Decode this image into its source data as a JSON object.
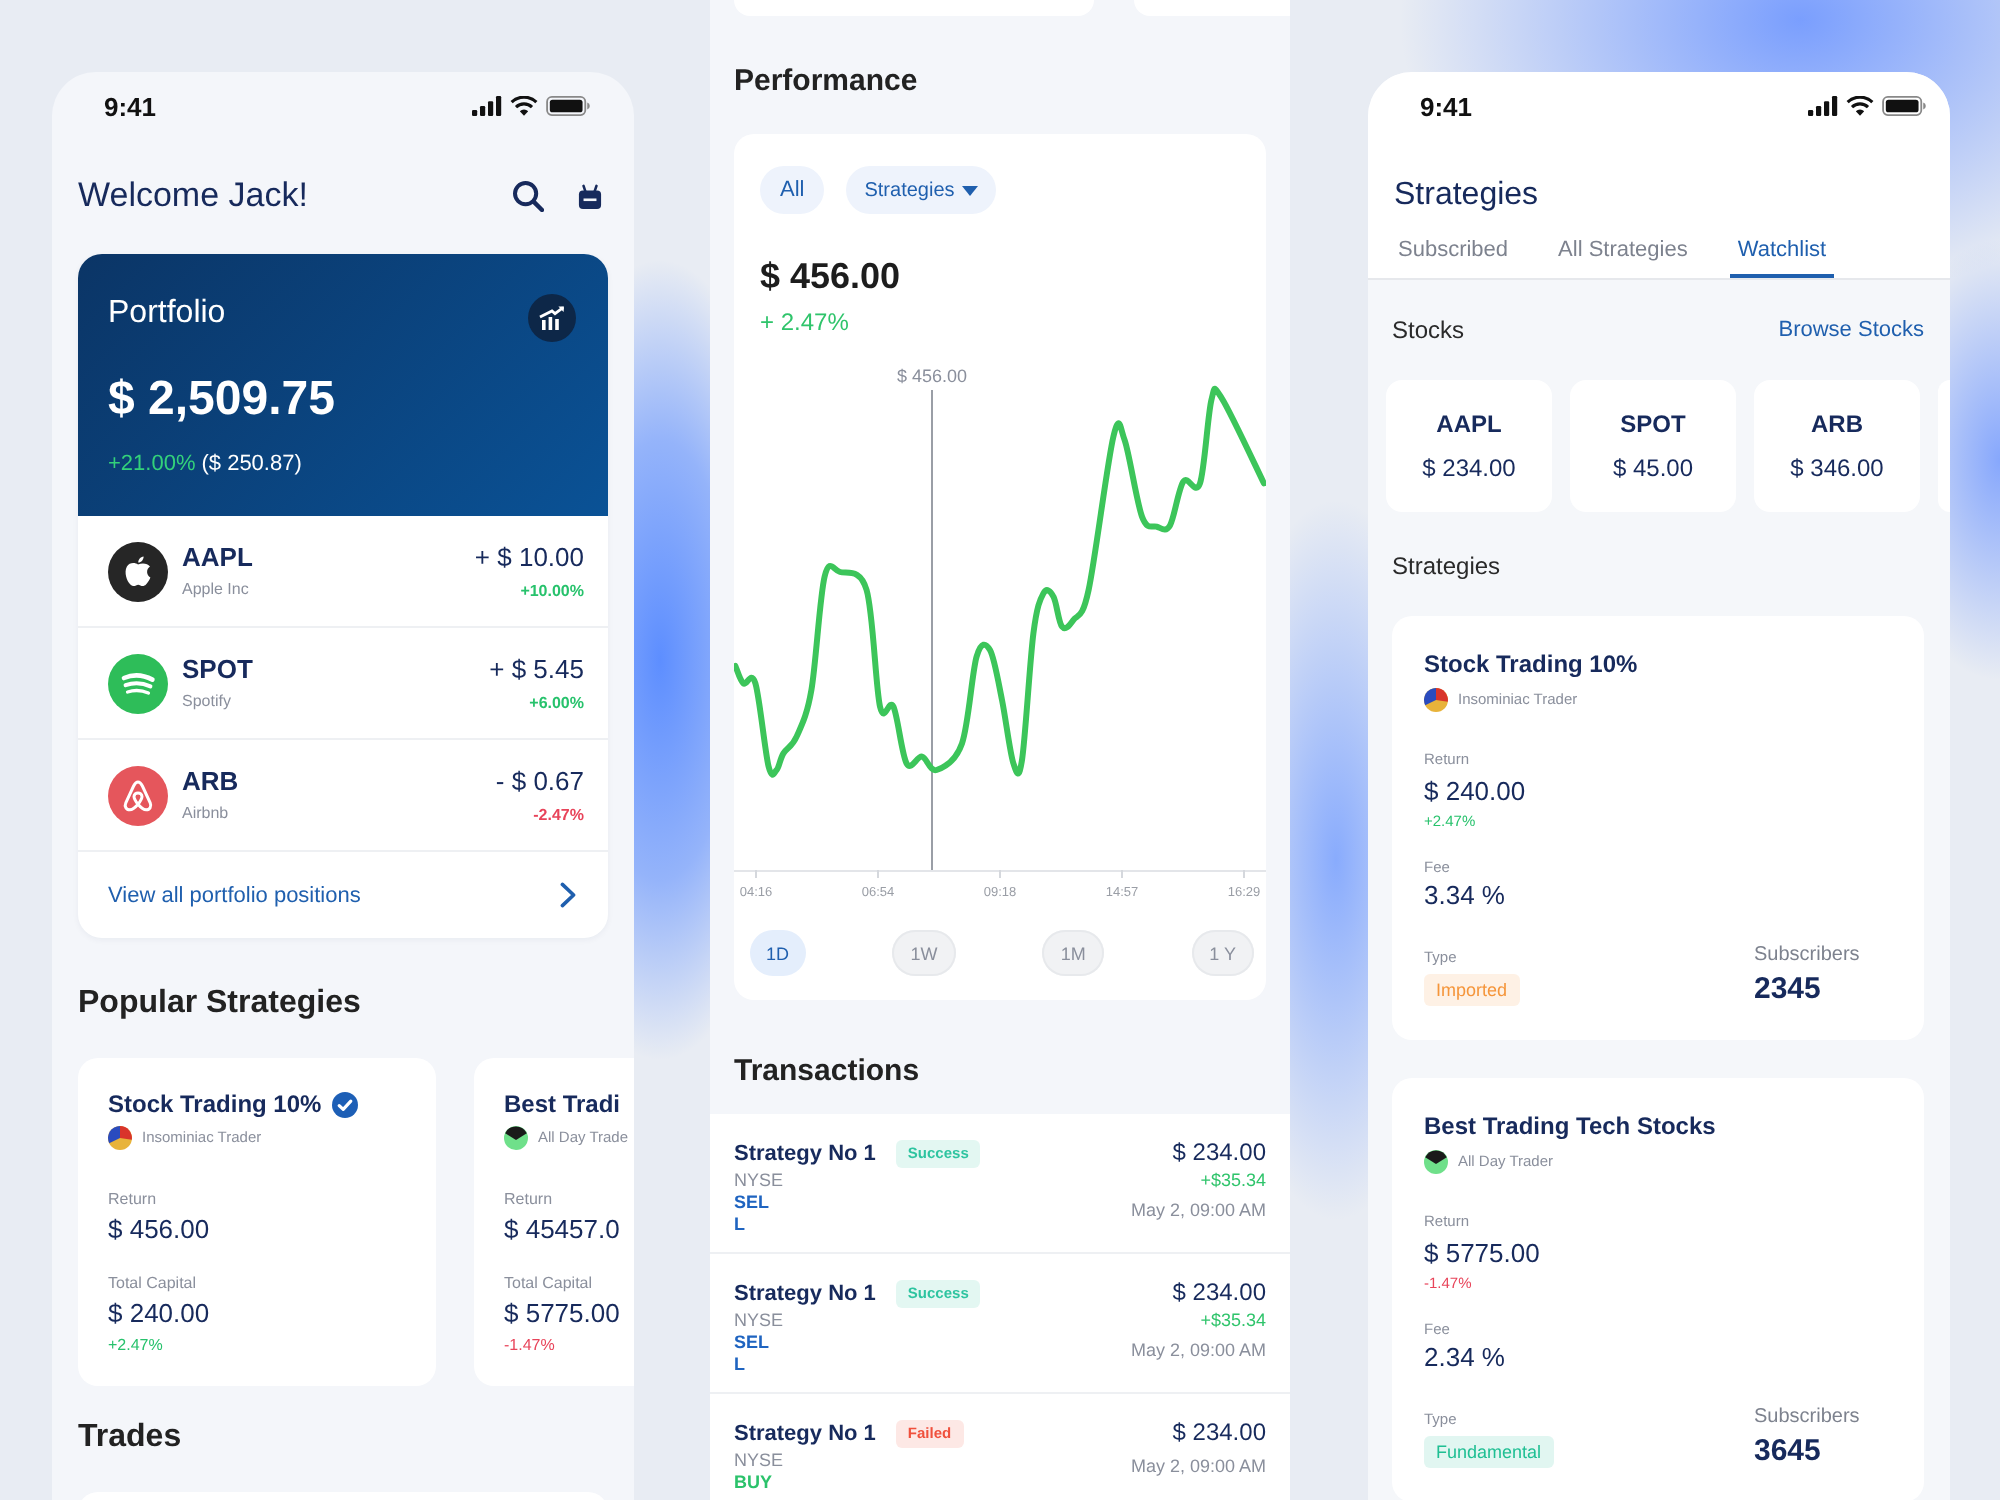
{
  "home_screen": {
    "status_bar": {
      "time": "9:41"
    },
    "header": {
      "title": "Welcome Jack!"
    },
    "portfolio": {
      "title": "Portfolio",
      "value": "$ 2,509.75",
      "change_percent": "+21.00%",
      "change_amount": "($ 250.87)"
    },
    "positions": [
      {
        "ticker": "AAPL",
        "company": "Apple Inc",
        "change": "+ $ 10.00",
        "change_percent": "+10.00%",
        "negative": false,
        "color": "#262626"
      },
      {
        "ticker": "SPOT",
        "company": "Spotify",
        "change": "+ $ 5.45",
        "change_percent": "+6.00%",
        "negative": false,
        "color": "#2ebd59"
      },
      {
        "ticker": "ARB",
        "company": "Airbnb",
        "change": "- $ 0.67",
        "change_percent": "-2.47%",
        "negative": true,
        "color": "#e5565c"
      }
    ],
    "view_all_link": "View all portfolio positions",
    "popular_strategies": {
      "title": "Popular Strategies",
      "cards": [
        {
          "title": "Stock Trading 10%",
          "verified": true,
          "trader": "Insominiac Trader",
          "return_label": "Return",
          "return_value": "$ 456.00",
          "capital_label": "Total Capital",
          "capital_value": "$ 240.00",
          "change": "+2.47%",
          "negative": false
        },
        {
          "title": "Best Tradi",
          "verified": false,
          "trader": "All Day Trade",
          "return_label": "Return",
          "return_value": "$ 45457.0",
          "capital_label": "Total Capital",
          "capital_value": "$ 5775.00",
          "change": "-1.47%",
          "negative": true
        }
      ]
    },
    "trades": {
      "title": "Trades"
    }
  },
  "performance_screen": {
    "title": "Performance",
    "filters": [
      {
        "label": "All",
        "dropdown": false
      },
      {
        "label": "Strategies",
        "dropdown": true
      }
    ],
    "price": "$ 456.00",
    "change": "+ 2.47%",
    "chart": {
      "marker_label": "$ 456.00",
      "x_labels": [
        "04:16",
        "06:54",
        "09:18",
        "14:57",
        "16:29"
      ]
    },
    "ranges": [
      {
        "label": "1D",
        "selected": true
      },
      {
        "label": "1W",
        "selected": false
      },
      {
        "label": "1M",
        "selected": false
      },
      {
        "label": "1 Y",
        "selected": false
      }
    ],
    "transactions": {
      "title": "Transactions",
      "rows": [
        {
          "name": "Strategy No 1",
          "status": {
            "label": "Success",
            "color": "#2ec4a0"
          },
          "exchange": "NYSE",
          "side": {
            "label": "SELL",
            "color": "#1f64c0"
          },
          "amount": "$ 234.00",
          "profit": "+$35.34",
          "time": "May 2, 09:00 AM"
        },
        {
          "name": "Strategy No 1",
          "status": {
            "label": "Success",
            "color": "#2ec4a0"
          },
          "exchange": "NYSE",
          "side": {
            "label": "SELL",
            "color": "#1f64c0"
          },
          "amount": "$ 234.00",
          "profit": "+$35.34",
          "time": "May 2, 09:00 AM"
        },
        {
          "name": "Strategy No 1",
          "status": {
            "label": "Failed",
            "color": "#f0503c"
          },
          "exchange": "NYSE",
          "side": {
            "label": "BUY",
            "color": "#2bc26b"
          },
          "amount": "$ 234.00",
          "time": "May 2, 09:00 AM"
        }
      ]
    }
  },
  "strategies_screen": {
    "status_bar": {
      "time": "9:41"
    },
    "title": "Strategies",
    "tabs": [
      {
        "label": "Subscribed",
        "selected": false
      },
      {
        "label": "All Strategies",
        "selected": false
      },
      {
        "label": "Watchlist",
        "selected": true
      }
    ],
    "stocks": {
      "title": "Stocks",
      "link": "Browse Stocks",
      "items": [
        {
          "ticker": "AAPL",
          "price": "$ 234.00"
        },
        {
          "ticker": "SPOT",
          "price": "$ 45.00"
        },
        {
          "ticker": "ARB",
          "price": "$ 346.00"
        }
      ]
    },
    "strategies": {
      "title": "Strategies",
      "cards": [
        {
          "title": "Stock Trading 10%",
          "trader": "Insominiac Trader",
          "return_label": "Return",
          "return_value": "$ 240.00",
          "change": "+2.47%",
          "negative": false,
          "fee_label": "Fee",
          "fee_value": "3.34 %",
          "type_label": "Type",
          "type": {
            "label": "Imported",
            "color": "#f5953a"
          },
          "subscribers_label": "Subscribers",
          "subscribers": "2345"
        },
        {
          "title": "Best Trading Tech Stocks",
          "trader": "All Day Trader",
          "return_label": "Return",
          "return_value": "$ 5775.00",
          "change": "-1.47%",
          "negative": true,
          "fee_label": "Fee",
          "fee_value": "2.34 %",
          "type_label": "Type",
          "type": {
            "label": "Fundamental",
            "color": "#1fbf93"
          },
          "subscribers_label": "Subscribers",
          "subscribers": "3645"
        }
      ]
    }
  }
}
